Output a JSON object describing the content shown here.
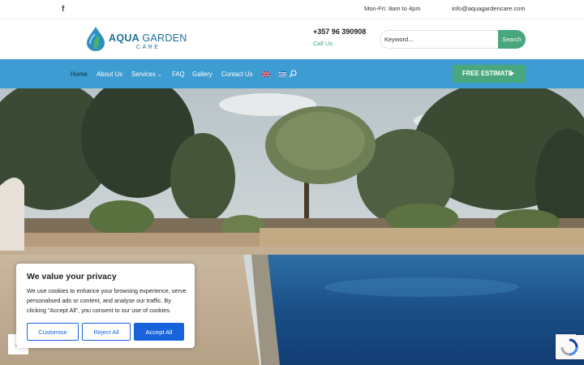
{
  "topbar": {
    "facebook_icon": "facebook-icon",
    "facebook_glyph": "f",
    "hours": "Mon-Fri: 8am to 4pm",
    "email": "info@aquagardencare.com"
  },
  "header": {
    "logo_title_a": "AQUA",
    "logo_title_b": "GARDEN",
    "logo_sub": "CARE",
    "phone": "+357 96 390908",
    "call_us": "Call Us",
    "search_placeholder": "Keyword...",
    "search_button": "Search"
  },
  "nav": {
    "items": [
      "Home",
      "About Us",
      "Services",
      "FAQ",
      "Gallery",
      "Contact Us"
    ],
    "services_caret": "⌄",
    "estimate_label": "FREE ESTIMATE",
    "estimate_arrow": "▶",
    "flags": [
      "uk-flag-icon",
      "greece-flag-icon"
    ]
  },
  "slider": {
    "prev_glyph": "←",
    "next_glyph": "→"
  },
  "cookie": {
    "title": "We value your privacy",
    "text": "We use cookies to enhance your browsing experience, serve personalised ads or content, and analyse our traffic. By clicking \"Accept All\", you consent to our use of cookies.",
    "customise": "Customise",
    "reject": "Reject All",
    "accept": "Accept All"
  },
  "colors": {
    "nav_blue": "#3d9cd1",
    "accent_green": "#49a77d",
    "cookie_blue": "#1863dc",
    "brand_blue": "#1e6e98"
  }
}
